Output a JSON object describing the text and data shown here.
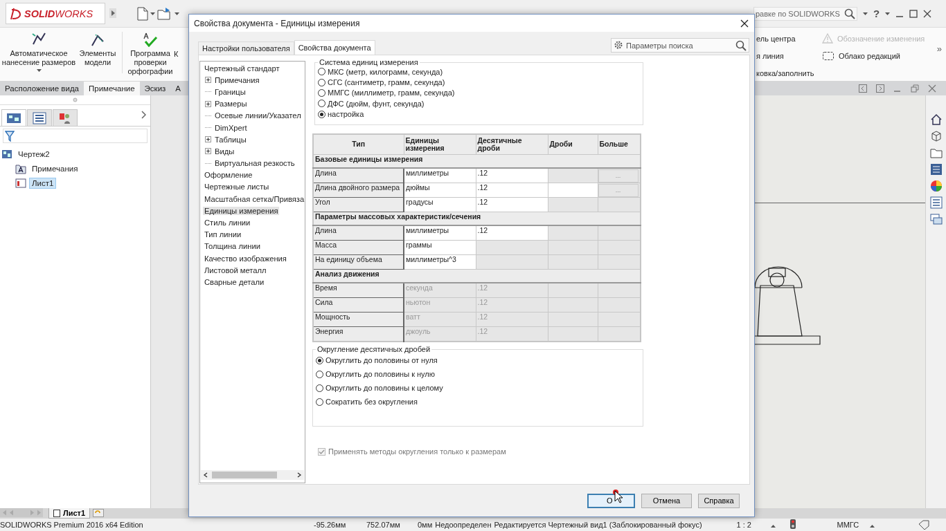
{
  "app": {
    "logo": "**SOLID**WORKS",
    "help_search": {
      "placeholder": "равке по SOLIDWORKS"
    },
    "help_label": "?"
  },
  "ribbon": {
    "left_commands": [
      {
        "kind": "autodim",
        "label": "Автоматическое нанесение размеров",
        "dropdown": true
      },
      {
        "kind": "items",
        "label": "Элементы модели",
        "dropdown": false
      },
      {
        "kind": "spelling",
        "label": "Программа проверки орфографии",
        "dropdown": false
      },
      {
        "kind": "clipped",
        "label": "К",
        "dropdown": false
      }
    ],
    "right_columns": [
      {
        "items": [
          {
            "kind": "clipped",
            "label": "ель центра",
            "disabled": false
          },
          {
            "kind": "clipped",
            "label": "я линия",
            "disabled": false
          },
          {
            "kind": "clipped",
            "label": "ковка/заполнить",
            "disabled": false
          }
        ]
      },
      {
        "items": [
          {
            "kind": "revision",
            "label": "Обозначение изменения",
            "disabled": true
          },
          {
            "kind": "cloud",
            "label": "Облако редакций",
            "disabled": false
          }
        ]
      }
    ],
    "overflow": "»"
  },
  "command_tabs": [
    {
      "label": "Расположение вида",
      "selected": false
    },
    {
      "label": "Примечание",
      "selected": true
    },
    {
      "label": "Эскиз",
      "selected": false
    },
    {
      "label": "А",
      "selected": false
    }
  ],
  "feature_manager": {
    "tabs": [
      {
        "kind": "tree",
        "selected": true
      },
      {
        "kind": "properties",
        "selected": false
      },
      {
        "kind": "config",
        "selected": false
      }
    ],
    "tree": [
      {
        "kind": "drawing",
        "label": "Чертеж2",
        "selected": false,
        "children": [
          {
            "kind": "annotations",
            "label": "Примечания",
            "selected": false
          },
          {
            "kind": "sheet",
            "label": "Лист1",
            "selected": true
          }
        ]
      }
    ]
  },
  "sheet_tabs": [
    {
      "label": "Лист1",
      "selected": true
    }
  ],
  "status_bar": {
    "product": "SOLIDWORKS Premium 2016 x64 Edition",
    "x": "-95.26мм",
    "y": "752.07мм",
    "z": "0мм",
    "state": "Недоопределен",
    "editing": "Редактируется Чертежный вид1 (Заблокированный фокус)",
    "scale": "1 : 2",
    "units": "ММГС"
  },
  "dialog": {
    "title": "Свойства документа - Единицы измерения",
    "tabs": [
      {
        "label": "Настройки пользователя",
        "selected": false
      },
      {
        "label": "Свойства документа",
        "selected": true
      }
    ],
    "search": {
      "placeholder": "Параметры поиска"
    },
    "tree": [
      {
        "label": "Чертежный стандарт",
        "selected": false,
        "children": [
          {
            "label": "Примечания",
            "expandable": true,
            "selected": false
          },
          {
            "label": "Границы",
            "expandable": false,
            "selected": false
          },
          {
            "label": "Размеры",
            "expandable": true,
            "selected": false
          },
          {
            "label": "Осевые линии/Указател",
            "expandable": false,
            "selected": false
          },
          {
            "label": "DimXpert",
            "expandable": false,
            "selected": false
          },
          {
            "label": "Таблицы",
            "expandable": true,
            "selected": false
          },
          {
            "label": "Виды",
            "expandable": true,
            "selected": false
          },
          {
            "label": "Виртуальная резкость",
            "expandable": false,
            "selected": false
          }
        ]
      },
      {
        "label": "Оформление",
        "selected": false
      },
      {
        "label": "Чертежные листы",
        "selected": false
      },
      {
        "label": "Масштабная сетка/Привяза",
        "selected": false
      },
      {
        "label": "Единицы измерения",
        "selected": true
      },
      {
        "label": "Стиль линии",
        "selected": false
      },
      {
        "label": "Тип линии",
        "selected": false
      },
      {
        "label": "Толщина линии",
        "selected": false
      },
      {
        "label": "Качество изображения",
        "selected": false
      },
      {
        "label": "Листовой металл",
        "selected": false
      },
      {
        "label": "Сварные детали",
        "selected": false
      }
    ],
    "unit_system": {
      "title": "Система единиц измерения",
      "options": [
        {
          "label": "МКС (метр, килограмм, секунда)",
          "selected": false
        },
        {
          "label": "СГС (сантиметр, грамм, секунда)",
          "selected": false
        },
        {
          "label": "ММГС (миллиметр, грамм, секунда)",
          "selected": false
        },
        {
          "label": "ДФС (дюйм, фунт, секунда)",
          "selected": false
        },
        {
          "label": "настройка",
          "selected": true
        }
      ]
    },
    "units_table": {
      "columns": [
        "Тип",
        "Единицы измерения",
        "Десятичные дроби",
        "Дроби",
        "Больше"
      ],
      "rows": [
        {
          "kind": "section",
          "label": "Базовые единицы измерения"
        },
        {
          "kind": "unit",
          "type": "Длина",
          "unit": "миллиметры",
          "decimals": ".12",
          "fractions_editable": false,
          "more": "...",
          "disabled": false
        },
        {
          "kind": "unit",
          "type": "Длина двойного размера",
          "unit": "дюймы",
          "decimals": ".12",
          "fractions_editable": true,
          "more": "...",
          "disabled": false
        },
        {
          "kind": "unit",
          "type": "Угол",
          "unit": "градусы",
          "decimals": ".12",
          "fractions_editable": false,
          "disabled": false
        },
        {
          "kind": "section",
          "label": "Параметры массовых характеристик/сечения"
        },
        {
          "kind": "unit",
          "type": "Длина",
          "unit": "миллиметры",
          "decimals": ".12",
          "fractions_editable": false,
          "disabled": false
        },
        {
          "kind": "unit",
          "type": "Масса",
          "unit": "граммы",
          "fractions_editable": false,
          "disabled": false
        },
        {
          "kind": "unit",
          "type": "На единицу объема",
          "unit": "миллиметры^3",
          "fractions_editable": false,
          "disabled": false
        },
        {
          "kind": "section",
          "label": "Анализ движения"
        },
        {
          "kind": "unit",
          "type": "Время",
          "unit": "секунда",
          "decimals": ".12",
          "fractions_editable": false,
          "disabled": true
        },
        {
          "kind": "unit",
          "type": "Сила",
          "unit": "ньютон",
          "decimals": ".12",
          "fractions_editable": false,
          "disabled": true
        },
        {
          "kind": "unit",
          "type": "Мощность",
          "unit": "ватт",
          "decimals": ".12",
          "fractions_editable": false,
          "disabled": true
        },
        {
          "kind": "unit",
          "type": "Энергия",
          "unit": "джоуль",
          "decimals": ".12",
          "fractions_editable": false,
          "disabled": true
        }
      ]
    },
    "rounding": {
      "title": "Округление десятичных дробей",
      "options": [
        {
          "label": "Округлить до половины от нуля",
          "selected": true
        },
        {
          "label": "Округлить до половины к нулю",
          "selected": false
        },
        {
          "label": "Округлить до половины к целому",
          "selected": false
        },
        {
          "label": "Сократить без округления",
          "selected": false
        }
      ]
    },
    "apply_rounding": {
      "label": "Применять методы округления только к размерам",
      "checked": true,
      "disabled": true
    },
    "buttons": [
      {
        "label": "O",
        "default": true
      },
      {
        "label": "Отмена",
        "default": false
      },
      {
        "label": "Справка",
        "default": false
      }
    ]
  }
}
